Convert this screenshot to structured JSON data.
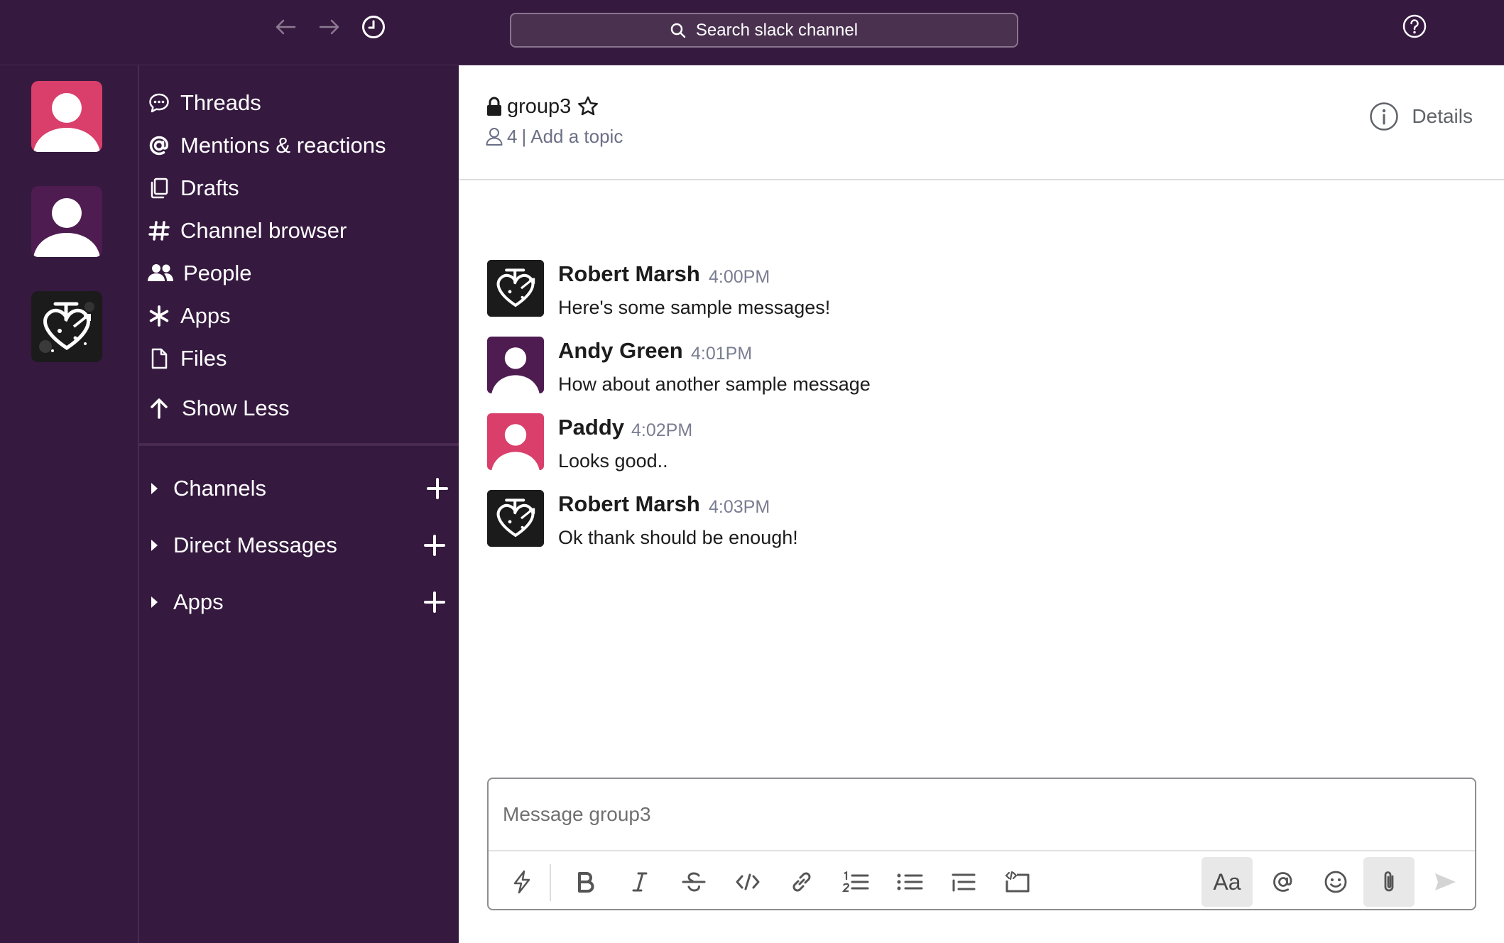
{
  "topbar": {
    "search_label": "Search slack channel",
    "icons": [
      "back-arrow-icon",
      "forward-arrow-icon",
      "history-clock-icon",
      "search-icon",
      "help-icon"
    ]
  },
  "workspaces": [
    {
      "name": "workspace-1",
      "color": "#d93f6a",
      "icon": "person-icon"
    },
    {
      "name": "workspace-2",
      "color": "#5a1d5b",
      "icon": "person-icon"
    },
    {
      "name": "workspace-3",
      "icon": "heart-graffiti-image"
    }
  ],
  "sidebar": {
    "items": [
      {
        "label": "Threads",
        "icon": "threads-icon"
      },
      {
        "label": "Mentions & reactions",
        "icon": "at-icon"
      },
      {
        "label": "Drafts",
        "icon": "drafts-icon"
      },
      {
        "label": "Channel browser",
        "icon": "hash-icon"
      },
      {
        "label": "People",
        "icon": "people-icon"
      },
      {
        "label": "Apps",
        "icon": "apps-asterisk-icon"
      },
      {
        "label": "Files",
        "icon": "file-icon"
      },
      {
        "label": "Show Less",
        "icon": "arrow-up-icon"
      }
    ],
    "sections": [
      {
        "label": "Channels"
      },
      {
        "label": "Direct Messages"
      },
      {
        "label": "Apps"
      }
    ]
  },
  "channel": {
    "name": "group3",
    "member_count": "4",
    "separator": "|",
    "topic_placeholder": "Add a topic",
    "details_label": "Details"
  },
  "messages": [
    {
      "author": "Robert Marsh",
      "time": "4:00PM",
      "text": "Here's some sample messages!",
      "avatar": "heart-graffiti-image"
    },
    {
      "author": "Andy Green",
      "time": "4:01PM",
      "text": "How about another sample message",
      "avatar": "purple-person-avatar"
    },
    {
      "author": "Paddy",
      "time": "4:02PM",
      "text": "Looks good..",
      "avatar": "pink-person-avatar"
    },
    {
      "author": "Robert Marsh",
      "time": "4:03PM",
      "text": "Ok thank should be enough!",
      "avatar": "heart-graffiti-image"
    }
  ],
  "composer": {
    "placeholder": "Message group3",
    "format_label": "Aa",
    "tools": [
      "shortcuts-icon",
      "bold-icon",
      "italic-icon",
      "strikethrough-icon",
      "code-icon",
      "link-icon",
      "ordered-list-icon",
      "bulleted-list-icon",
      "blockquote-icon",
      "code-block-icon",
      "formatting-icon",
      "mention-icon",
      "emoji-icon",
      "attach-icon",
      "send-icon"
    ]
  },
  "colors": {
    "aubergine": "#35193f",
    "pink_avatar": "#d93f6a",
    "purple_avatar": "#5a1d5b"
  }
}
